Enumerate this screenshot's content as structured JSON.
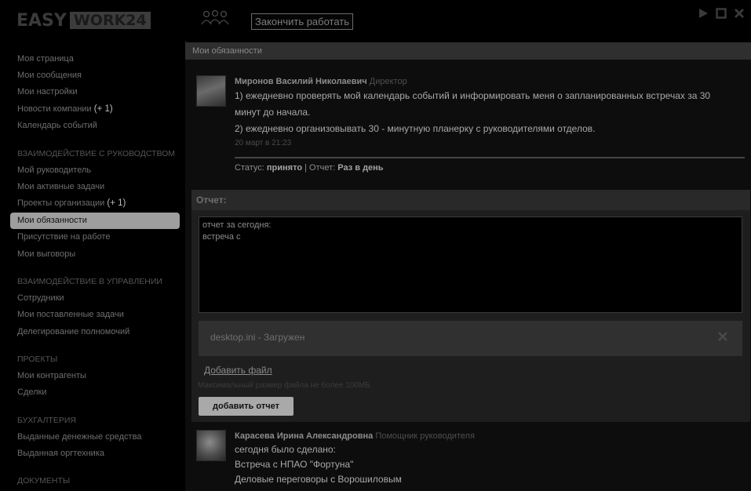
{
  "header": {
    "logo_part1": "EASY",
    "logo_part2": "WORK24",
    "finish_button": "Закончить работать"
  },
  "sidebar": {
    "items": [
      {
        "label": "Моя страница"
      },
      {
        "label": "Мои сообщения"
      },
      {
        "label": "Мои настройки"
      },
      {
        "label": "Новости компании",
        "badge": "(+ 1)"
      },
      {
        "label": "Календарь событий"
      }
    ],
    "section_mgmt": "ВЗАИМОДЕЙСТВИЕ С РУКОВОДСТВОМ",
    "mgmt_items": [
      {
        "label": "Мой руководитель"
      },
      {
        "label": "Мои активные задачи"
      },
      {
        "label": "Проекты организации",
        "badge": "(+ 1)"
      },
      {
        "label": "Мои обязанности"
      },
      {
        "label": "Присутствие на работе"
      },
      {
        "label": "Мои выговоры"
      }
    ],
    "section_ctrl": "ВЗАИМОДЕЙСТВИЕ В УПРАВЛЕНИИ",
    "ctrl_items": [
      {
        "label": "Сотрудники"
      },
      {
        "label": "Мои поставленные задачи"
      },
      {
        "label": "Делегирование полномочий"
      }
    ],
    "section_projects": "ПРОЕКТЫ",
    "project_items": [
      {
        "label": "Мои контрагенты"
      },
      {
        "label": "Сделки"
      }
    ],
    "section_acc": "БУХГАЛТЕРИЯ",
    "acc_items": [
      {
        "label": "Выданные денежные средства"
      },
      {
        "label": "Выданная оргтехника"
      }
    ],
    "section_docs": "ДОКУМЕНТЫ"
  },
  "main": {
    "title": "Мои обязанности",
    "entry1": {
      "author": "Миронов Василий Николаевич",
      "role": "Директор",
      "lines": [
        "1) ежедневно проверять мой календарь событий и информировать меня о запланированных встречах за 30",
        "минут до начала.",
        "2) ежедневно организовывать 30 - минутную планерку с руководителями отделов."
      ],
      "date": "20 март в 21:23",
      "status_label": "Статус:",
      "status_value": "принято",
      "report_label": "Отчет:",
      "report_value": "Раз в день"
    },
    "report": {
      "title": "Отчет:",
      "text_line1": "отчет за сегодня:",
      "text_line2": "встреча с",
      "file_name": "desktop.ini - Загружен",
      "add_file": "Добавить файл",
      "max_size": "Максимальный размер файла не более 100МБ",
      "submit": "добавить отчет"
    },
    "entry2": {
      "author": "Карасева Ирина Александровна",
      "role": "Помощник руководителя",
      "lines": [
        "сегодня было сделано:",
        "Встреча с НПАО \"Фортуна\"",
        "Деловые переговоры с Ворошиловым"
      ]
    }
  }
}
